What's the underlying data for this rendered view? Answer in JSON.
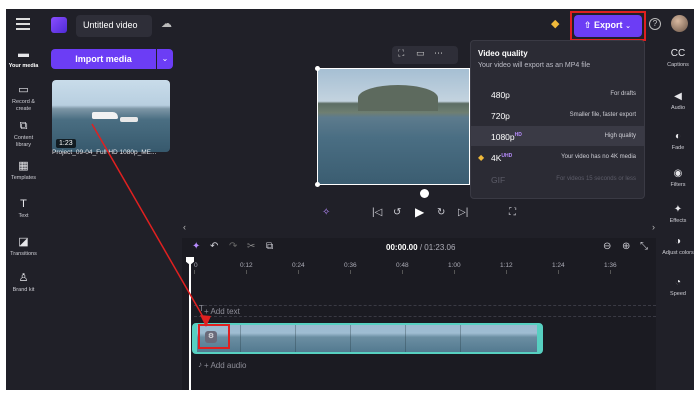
{
  "header": {
    "project_title": "Untitled video",
    "export_label": "Export",
    "export_chevron": "⌄",
    "help_label": "?"
  },
  "left_nav": [
    {
      "label": "Your media",
      "icon": "folder-icon",
      "glyph": "▬"
    },
    {
      "label": "Record & create",
      "icon": "camera-icon",
      "glyph": "▭"
    },
    {
      "label": "Content library",
      "icon": "library-icon",
      "glyph": "⧉"
    },
    {
      "label": "Templates",
      "icon": "templates-icon",
      "glyph": "▦"
    },
    {
      "label": "Text",
      "icon": "text-icon",
      "glyph": "T"
    },
    {
      "label": "Transitions",
      "icon": "transitions-icon",
      "glyph": "◪"
    },
    {
      "label": "Brand kit",
      "icon": "brand-kit-icon",
      "glyph": "♙"
    }
  ],
  "media": {
    "import_label": "Import media",
    "import_dropdown": "⌄",
    "clip_duration": "1:23",
    "clip_name": "Project_09-04_Full HD 1080p_ME..."
  },
  "export_menu": {
    "title": "Video quality",
    "subtitle": "Your video will export as an MP4 file",
    "options": [
      {
        "label": "480p",
        "badge": "",
        "desc": "For drafts",
        "state": "normal"
      },
      {
        "label": "720p",
        "badge": "",
        "desc": "Smaller file, faster export",
        "state": "normal"
      },
      {
        "label": "1080p",
        "badge": "HD",
        "desc": "High quality",
        "state": "selected"
      },
      {
        "label": "4K",
        "badge": "UHD",
        "desc": "Your video has no 4K media",
        "state": "premium"
      },
      {
        "label": "GIF",
        "badge": "",
        "desc": "For videos 15 seconds or less",
        "state": "disabled"
      }
    ]
  },
  "right_nav": [
    {
      "label": "Captions",
      "icon": "captions-icon",
      "glyph": "CC"
    },
    {
      "label": "Audio",
      "icon": "speaker-icon",
      "glyph": "◀"
    },
    {
      "label": "Fade",
      "icon": "fade-icon",
      "glyph": "◐"
    },
    {
      "label": "Filters",
      "icon": "filters-icon",
      "glyph": "◉"
    },
    {
      "label": "Effects",
      "icon": "effects-icon",
      "glyph": "✦"
    },
    {
      "label": "Adjust colors",
      "icon": "adjust-colors-icon",
      "glyph": "◑"
    },
    {
      "label": "Speed",
      "icon": "speed-icon",
      "glyph": "◔"
    }
  ],
  "timeline": {
    "current_time": "00:00.00",
    "total_time": "/ 01:23.06",
    "ticks": [
      "0",
      "0:12",
      "0:24",
      "0:36",
      "0:48",
      "1:00",
      "1:12",
      "1:24",
      "1:36"
    ],
    "add_text": "+ Add text",
    "add_audio": "+ Add audio"
  },
  "colors": {
    "accent": "#6c3df5",
    "highlight": "#e02020",
    "clip_border": "#57d0c1",
    "background": "#202028"
  }
}
